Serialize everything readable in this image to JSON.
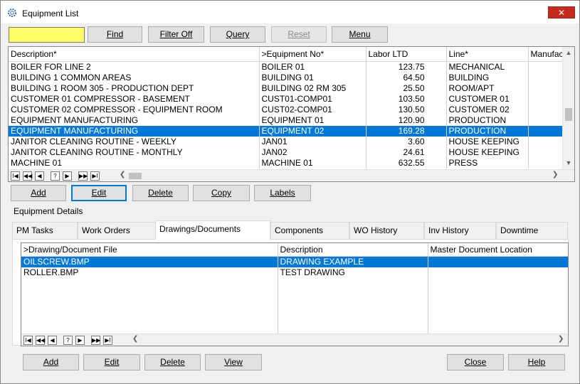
{
  "window": {
    "title": "Equipment List",
    "close_glyph": "✕"
  },
  "toolbar": {
    "search_value": "",
    "find": "Find",
    "filter_off": "Filter Off",
    "query": "Query",
    "reset": "Reset",
    "menu": "Menu"
  },
  "equipment_grid": {
    "columns": [
      "Description*",
      ">Equipment No*",
      "Labor LTD",
      "Line*",
      "Manufac"
    ],
    "rows": [
      [
        "BOILER FOR LINE 2",
        "BOILER 01",
        "123.75",
        "MECHANICAL",
        ""
      ],
      [
        "BUILDING 1 COMMON AREAS",
        "BUILDING 01",
        "64.50",
        "BUILDING",
        ""
      ],
      [
        "BUILDING 1 ROOM 305 - PRODUCTION DEPT",
        "BUILDING 02 RM 305",
        "25.50",
        "ROOM/APT",
        ""
      ],
      [
        "CUSTOMER 01 COMPRESSOR - BASEMENT",
        "CUST01-COMP01",
        "103.50",
        "CUSTOMER 01",
        ""
      ],
      [
        "CUSTOMER 02 COMPRESSOR - EQUIPMENT ROOM",
        "CUST02-COMP01",
        "130.50",
        "CUSTOMER 02",
        ""
      ],
      [
        "EQUIPMENT MANUFACTURING",
        "EQUIPMENT 01",
        "120.90",
        "PRODUCTION",
        ""
      ],
      [
        "EQUIPMENT MANUFACTURING",
        "EQUIPMENT 02",
        "169.28",
        "PRODUCTION",
        ""
      ],
      [
        "JANITOR CLEANING ROUTINE - WEEKLY",
        "JAN01",
        "3.60",
        "HOUSE KEEPING",
        ""
      ],
      [
        "JANITOR CLEANING ROUTINE - MONTHLY",
        "JAN02",
        "24.61",
        "HOUSE KEEPING",
        ""
      ],
      [
        "MACHINE 01",
        "MACHINE 01",
        "632.55",
        "PRESS",
        ""
      ]
    ],
    "selected_row": 6
  },
  "navigator": {
    "first": "I◀",
    "prev_page": "◀◀",
    "prev": "◀",
    "query": "?",
    "next": "▶",
    "next_page": "▶▶",
    "last": "▶I"
  },
  "equipment_actions": {
    "add": "Add",
    "edit": "Edit",
    "delete": "Delete",
    "copy": "Copy",
    "labels": "Labels"
  },
  "details": {
    "group_label": "Equipment Details",
    "tabs": [
      "PM Tasks",
      "Work Orders",
      "Drawings/Documents",
      "Components",
      "WO History",
      "Inv History",
      "Downtime"
    ],
    "active_tab": 2
  },
  "drawings_grid": {
    "columns": [
      ">Drawing/Document File",
      "Description",
      "Master Document Location"
    ],
    "rows": [
      [
        "OILSCREW.BMP",
        "DRAWING EXAMPLE",
        ""
      ],
      [
        "ROLLER.BMP",
        "TEST DRAWING",
        ""
      ]
    ],
    "selected_row": 0
  },
  "drawing_actions": {
    "add": "Add",
    "edit": "Edit",
    "delete": "Delete",
    "view": "View"
  },
  "footer": {
    "close": "Close",
    "help": "Help"
  },
  "icons": {
    "title": "gear-icon",
    "close": "close-icon",
    "scroll_left": "chevron-left-icon",
    "scroll_right": "chevron-right-icon",
    "scroll_up": "chevron-up-icon",
    "scroll_down": "chevron-down-icon"
  },
  "colors": {
    "selection": "#0078d7",
    "search_bg": "#ffff66",
    "close_bg": "#c42b1c"
  }
}
